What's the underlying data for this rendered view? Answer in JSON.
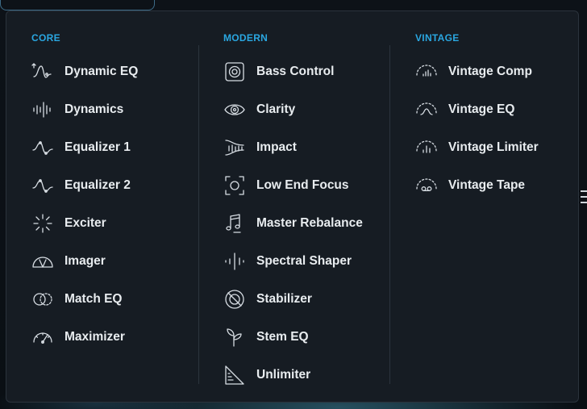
{
  "menu": {
    "columns": [
      {
        "key": "core",
        "title": "CORE",
        "items": [
          {
            "label": "Dynamic EQ",
            "icon": "dynamic-eq-icon"
          },
          {
            "label": "Dynamics",
            "icon": "dynamics-icon"
          },
          {
            "label": "Equalizer 1",
            "icon": "equalizer-icon"
          },
          {
            "label": "Equalizer 2",
            "icon": "equalizer-icon"
          },
          {
            "label": "Exciter",
            "icon": "exciter-icon"
          },
          {
            "label": "Imager",
            "icon": "imager-icon"
          },
          {
            "label": "Match EQ",
            "icon": "match-eq-icon"
          },
          {
            "label": "Maximizer",
            "icon": "maximizer-icon"
          }
        ]
      },
      {
        "key": "modern",
        "title": "MODERN",
        "items": [
          {
            "label": "Bass Control",
            "icon": "speaker-icon"
          },
          {
            "label": "Clarity",
            "icon": "eye-icon"
          },
          {
            "label": "Impact",
            "icon": "impact-icon"
          },
          {
            "label": "Low End Focus",
            "icon": "focus-icon"
          },
          {
            "label": "Master Rebalance",
            "icon": "music-note-icon"
          },
          {
            "label": "Spectral Shaper",
            "icon": "spectral-shaper-icon"
          },
          {
            "label": "Stabilizer",
            "icon": "stabilizer-icon"
          },
          {
            "label": "Stem EQ",
            "icon": "stem-icon"
          },
          {
            "label": "Unlimiter",
            "icon": "unlimiter-icon"
          }
        ]
      },
      {
        "key": "vintage",
        "title": "VINTAGE",
        "items": [
          {
            "label": "Vintage Comp",
            "icon": "vintage-comp-icon"
          },
          {
            "label": "Vintage EQ",
            "icon": "vintage-eq-icon"
          },
          {
            "label": "Vintage Limiter",
            "icon": "vintage-limiter-icon"
          },
          {
            "label": "Vintage Tape",
            "icon": "vintage-tape-icon"
          }
        ]
      }
    ]
  },
  "colors": {
    "accent": "#2aa7e1",
    "panel_bg": "#161c23",
    "text": "#e8ecef"
  }
}
